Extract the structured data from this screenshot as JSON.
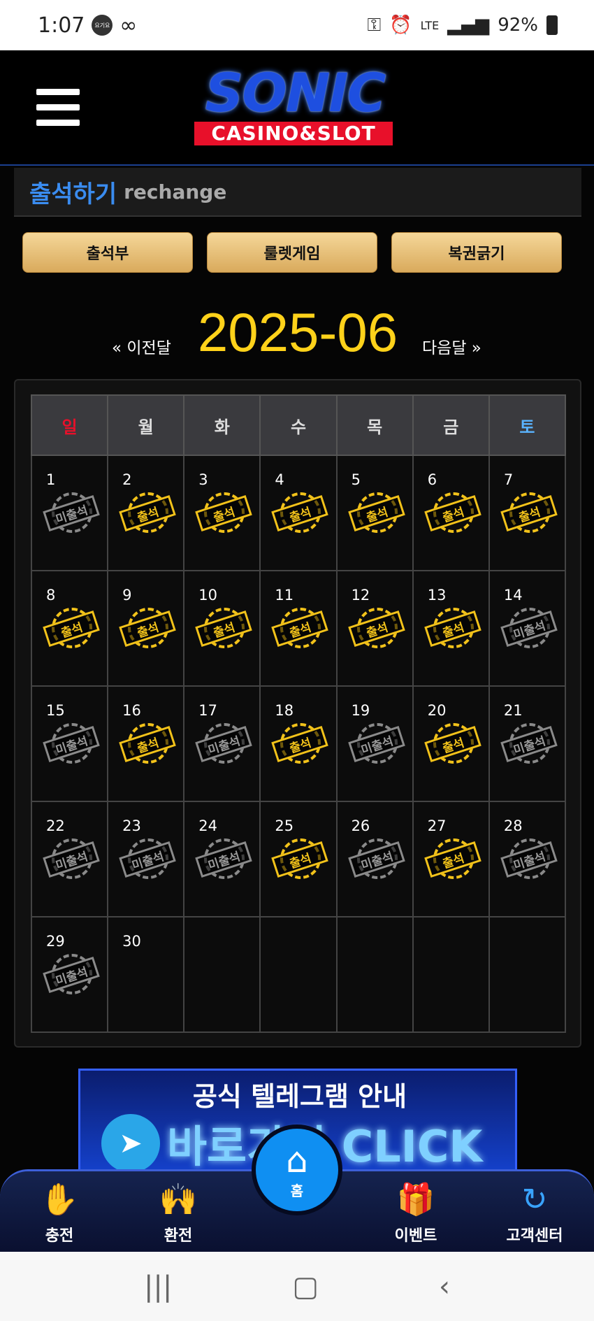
{
  "status_bar": {
    "time": "1:07",
    "badge": "요기요",
    "battery": "92%",
    "network": "LTE"
  },
  "header": {
    "logo_main": "SONIC",
    "logo_sub": "CASINO&SLOT"
  },
  "section": {
    "title": "출석하기",
    "subtitle": "rechange"
  },
  "tabs": [
    {
      "label": "출석부"
    },
    {
      "label": "룰렛게임"
    },
    {
      "label": "복권긁기"
    }
  ],
  "month_nav": {
    "prev": "« 이전달",
    "current": "2025-06",
    "next": "다음달 »"
  },
  "calendar": {
    "weekdays": [
      "일",
      "월",
      "화",
      "수",
      "목",
      "금",
      "토"
    ],
    "weekday_colors": [
      "#e8102a",
      "#dddddd",
      "#dddddd",
      "#dddddd",
      "#dddddd",
      "#dddddd",
      "#5ab4ff"
    ],
    "stamp_labels": {
      "attended": "출석",
      "absent": "미출석"
    },
    "weeks": [
      [
        {
          "day": "1",
          "status": "absent"
        },
        {
          "day": "2",
          "status": "attended"
        },
        {
          "day": "3",
          "status": "attended"
        },
        {
          "day": "4",
          "status": "attended"
        },
        {
          "day": "5",
          "status": "attended"
        },
        {
          "day": "6",
          "status": "attended"
        },
        {
          "day": "7",
          "status": "attended"
        }
      ],
      [
        {
          "day": "8",
          "status": "attended"
        },
        {
          "day": "9",
          "status": "attended"
        },
        {
          "day": "10",
          "status": "attended"
        },
        {
          "day": "11",
          "status": "attended"
        },
        {
          "day": "12",
          "status": "attended"
        },
        {
          "day": "13",
          "status": "attended"
        },
        {
          "day": "14",
          "status": "absent"
        }
      ],
      [
        {
          "day": "15",
          "status": "absent"
        },
        {
          "day": "16",
          "status": "attended"
        },
        {
          "day": "17",
          "status": "absent"
        },
        {
          "day": "18",
          "status": "attended"
        },
        {
          "day": "19",
          "status": "absent"
        },
        {
          "day": "20",
          "status": "attended"
        },
        {
          "day": "21",
          "status": "absent"
        }
      ],
      [
        {
          "day": "22",
          "status": "absent"
        },
        {
          "day": "23",
          "status": "absent"
        },
        {
          "day": "24",
          "status": "absent"
        },
        {
          "day": "25",
          "status": "attended"
        },
        {
          "day": "26",
          "status": "absent"
        },
        {
          "day": "27",
          "status": "attended"
        },
        {
          "day": "28",
          "status": "absent"
        }
      ],
      [
        {
          "day": "29",
          "status": "absent"
        },
        {
          "day": "30",
          "status": "none"
        },
        {
          "day": "",
          "status": "none"
        },
        {
          "day": "",
          "status": "none"
        },
        {
          "day": "",
          "status": "none"
        },
        {
          "day": "",
          "status": "none"
        },
        {
          "day": "",
          "status": "none"
        }
      ]
    ]
  },
  "banner": {
    "title": "공식 텔레그램 안내",
    "cta": "바로가기 CLICK"
  },
  "bottom_nav": {
    "items": [
      {
        "label": "충전",
        "icon": "deposit-hand-icon"
      },
      {
        "label": "환전",
        "icon": "withdraw-hands-icon"
      },
      {
        "label": "이벤트",
        "icon": "gift-icon"
      },
      {
        "label": "고객센터",
        "icon": "support-24-icon"
      }
    ],
    "home": {
      "label": "홈",
      "icon": "home-icon"
    }
  },
  "colors": {
    "accent_blue": "#0f8ff2",
    "gold": "#ffd21a",
    "tab_gold": "#e6bd73"
  }
}
